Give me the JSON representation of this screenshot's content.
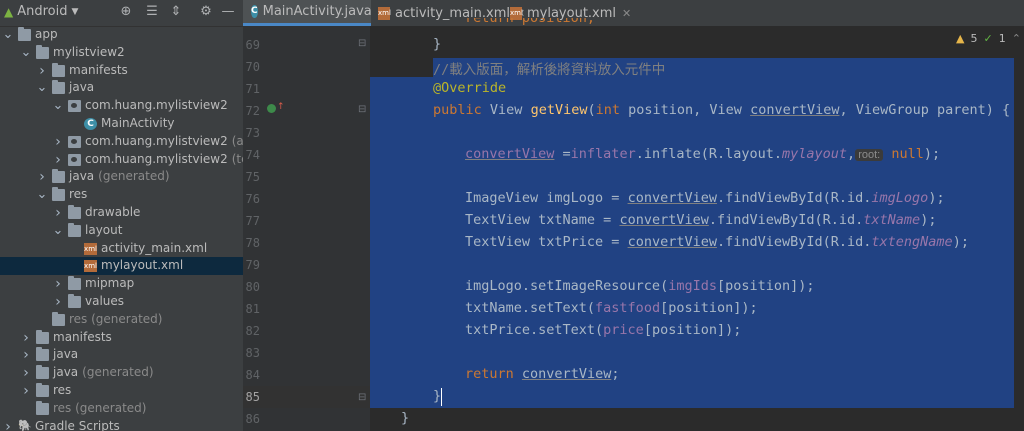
{
  "project_panel": {
    "view_selector": "Android",
    "tree": [
      {
        "label": "app",
        "extra": "",
        "icon": "folder-icon",
        "arrow": "down",
        "indent": 0
      },
      {
        "label": "mylistview2",
        "extra": "",
        "icon": "folder-icon",
        "arrow": "down",
        "indent": 1
      },
      {
        "label": "manifests",
        "extra": "",
        "icon": "folder-icon",
        "arrow": "right",
        "indent": 2
      },
      {
        "label": "java",
        "extra": "",
        "icon": "folder-icon",
        "arrow": "down",
        "indent": 2
      },
      {
        "label": "com.huang.mylistview2",
        "extra": "",
        "icon": "package-icon",
        "arrow": "down",
        "indent": 3
      },
      {
        "label": "MainActivity",
        "extra": "",
        "icon": "java-class-icon",
        "arrow": "",
        "indent": 4
      },
      {
        "label": "com.huang.mylistview2",
        "extra": "(andro",
        "icon": "package-icon",
        "arrow": "right",
        "indent": 3
      },
      {
        "label": "com.huang.mylistview2",
        "extra": "(test)",
        "icon": "package-icon",
        "arrow": "right",
        "indent": 3
      },
      {
        "label": "java",
        "extra": "(generated)",
        "icon": "folder-icon",
        "arrow": "right",
        "indent": 2
      },
      {
        "label": "res",
        "extra": "",
        "icon": "folder-icon",
        "arrow": "down",
        "indent": 2
      },
      {
        "label": "drawable",
        "extra": "",
        "icon": "folder-icon",
        "arrow": "right",
        "indent": 3
      },
      {
        "label": "layout",
        "extra": "",
        "icon": "folder-icon",
        "arrow": "down",
        "indent": 3
      },
      {
        "label": "activity_main.xml",
        "extra": "",
        "icon": "xml-file-icon",
        "arrow": "",
        "indent": 4
      },
      {
        "label": "mylayout.xml",
        "extra": "",
        "icon": "xml-file-icon",
        "arrow": "",
        "indent": 4,
        "selected": true
      },
      {
        "label": "mipmap",
        "extra": "",
        "icon": "folder-icon",
        "arrow": "right",
        "indent": 3
      },
      {
        "label": "values",
        "extra": "",
        "icon": "folder-icon",
        "arrow": "right",
        "indent": 3
      },
      {
        "label": "res (generated)",
        "extra": "",
        "icon": "folder-icon",
        "arrow": "",
        "indent": 2,
        "gray": true
      },
      {
        "label": "manifests",
        "extra": "",
        "icon": "folder-icon",
        "arrow": "right",
        "indent": 1
      },
      {
        "label": "java",
        "extra": "",
        "icon": "folder-icon",
        "arrow": "right",
        "indent": 1
      },
      {
        "label": "java",
        "extra": "(generated)",
        "icon": "folder-icon",
        "arrow": "right",
        "indent": 1
      },
      {
        "label": "res",
        "extra": "",
        "icon": "folder-icon",
        "arrow": "right",
        "indent": 1
      },
      {
        "label": "res (generated)",
        "extra": "",
        "icon": "folder-icon",
        "arrow": "",
        "indent": 1,
        "gray": true
      },
      {
        "label": "Gradle Scripts",
        "extra": "",
        "icon": "gradle-icon",
        "arrow": "right",
        "indent": 0
      }
    ]
  },
  "tabs": [
    {
      "label": "MainActivity.java",
      "icon": "java-class-icon",
      "active": true
    },
    {
      "label": "activity_main.xml",
      "icon": "xml-file-icon",
      "active": false
    },
    {
      "label": "mylayout.xml",
      "icon": "xml-file-icon",
      "active": false
    }
  ],
  "inspections": {
    "warnings": "5",
    "weak_warnings": "1"
  },
  "editor": {
    "line_numbers": [
      "69",
      "70",
      "71",
      "72",
      "73",
      "74",
      "75",
      "76",
      "77",
      "78",
      "79",
      "80",
      "81",
      "82",
      "83",
      "84",
      "85",
      "86"
    ],
    "current_line": "85",
    "param_hint": "root:",
    "code": {
      "l68_partial": "return position;",
      "l69": "}",
      "l70": "//載入版面，解析後將資料放入元件中",
      "l71": "@Override",
      "l72_kw1": "public",
      "l72_type": "View",
      "l72_name": "getView",
      "l72_rest1": "(",
      "l72_kw2": "int",
      "l72_rest2": " position, View ",
      "l72_cv": "convertView",
      "l72_rest3": ", ViewGroup parent) {",
      "l74_cv": "convertView",
      "l74_eq": " =",
      "l74_inflater": "inflater",
      "l74_rest": ".inflate(R.layout.",
      "l74_field": "mylayout",
      "l74_comma": ",",
      "l74_null": "null",
      "l74_end": ");",
      "l76_a": "ImageView imgLogo = ",
      "l76_cv": "convertView",
      "l76_b": ".findViewById(R.id.",
      "l76_f": "imgLogo",
      "l76_c": ");",
      "l77_a": "TextView txtName = ",
      "l77_cv": "convertView",
      "l77_b": ".findViewById(R.id.",
      "l77_f": "txtName",
      "l77_c": ");",
      "l78_a": "TextView txtPrice = ",
      "l78_cv": "convertView",
      "l78_b": ".findViewById(R.id.",
      "l78_f": "txtengName",
      "l78_c": ");",
      "l80_a": "imgLogo.setImageResource(",
      "l80_f": "imgIds",
      "l80_b": "[position]);",
      "l81_a": "txtName.setText(",
      "l81_f": "fastfood",
      "l81_b": "[position]);",
      "l82_a": "txtPrice.setText(",
      "l82_f": "price",
      "l82_b": "[position]);",
      "l84_kw": "return",
      "l84_cv": "convertView",
      "l84_end": ";",
      "l85": "}",
      "l86": "}"
    }
  },
  "colors": {
    "selection": "#214283",
    "keyword": "#cc7832",
    "method": "#ffc66d",
    "field": "#9876aa",
    "annotation": "#bbb529",
    "comment": "#808080"
  }
}
